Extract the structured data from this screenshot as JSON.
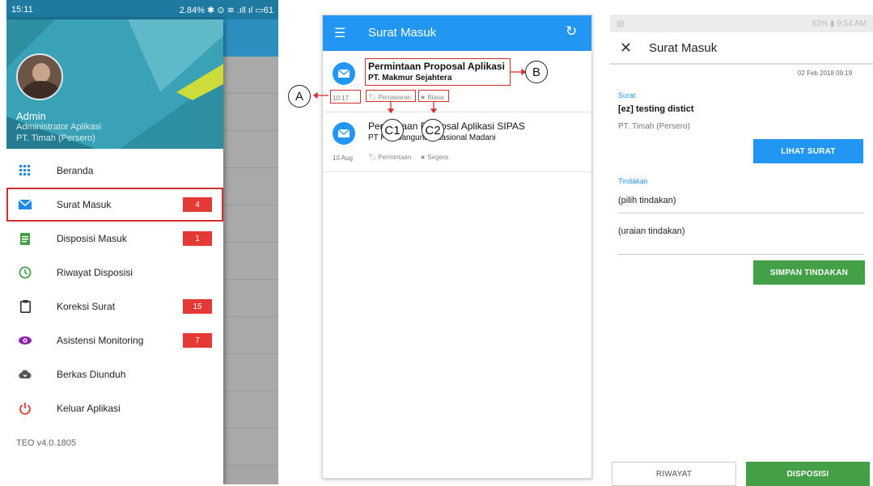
{
  "panel1": {
    "status": {
      "time": "15:11",
      "indicators": "2.84% ✱ ⊙ ≋ .ıll ıl ▭61"
    },
    "user": {
      "name": "Admin",
      "role": "Administrator Aplikasi",
      "org": "PT. Timah (Persero)"
    },
    "menu": [
      {
        "label": "Beranda",
        "icon": "grid-icon",
        "color": "#1e88e5"
      },
      {
        "label": "Surat Masuk",
        "icon": "envelope-icon",
        "color": "#1e88e5",
        "badge": "4"
      },
      {
        "label": "Disposisi Masuk",
        "icon": "document-icon",
        "color": "#43a047",
        "badge": "1"
      },
      {
        "label": "Riwayat Disposisi",
        "icon": "clock-icon",
        "color": "#43a047"
      },
      {
        "label": "Koreksi Surat",
        "icon": "clipboard-icon",
        "color": "#333333",
        "badge": "15"
      },
      {
        "label": "Asistensi Monitoring",
        "icon": "eye-icon",
        "color": "#8e24aa",
        "badge": "7"
      },
      {
        "label": "Berkas Diunduh",
        "icon": "cloud-download-icon",
        "color": "#555555"
      },
      {
        "label": "Keluar Aplikasi",
        "icon": "power-icon",
        "color": "#e53935"
      }
    ],
    "version": "TEO v4.0.1805"
  },
  "panel2": {
    "title": "Surat Masuk",
    "mails": [
      {
        "subject": "Permintaan Proposal Aplikasi",
        "sender": "PT. Makmur Sejahtera",
        "time": "10:17",
        "tags": [
          "Penawaran",
          "Biasa"
        ]
      },
      {
        "subject": "Permintaan Proposal Aplikasi SIPAS",
        "sender": "PT Pembangunan Nasional Madani",
        "time": "10 Aug",
        "tags": [
          "Permintaan",
          "Segera"
        ]
      }
    ],
    "annotations": {
      "a": "A",
      "b": "B",
      "c1": "C1",
      "c2": "C2"
    }
  },
  "panel3": {
    "status": {
      "battery": "63%",
      "time": "9:54 AM"
    },
    "title": "Surat Masuk",
    "date": "02 Feb 2018 09:19",
    "surat_label": "Surat",
    "surat_title": "[ez] testing distict",
    "surat_org": "PT. Timah (Persero)",
    "lihat_button": "LIHAT SURAT",
    "tindakan_label": "Tindakan",
    "pilih_placeholder": "(pilih tindakan)",
    "uraian_placeholder": "(uraian tindakan)",
    "simpan_button": "SIMPAN TINDAKAN",
    "riwayat_button": "RIWAYAT",
    "disposisi_button": "DISPOSISI",
    "accent_blue": "#2196f3",
    "accent_green": "#43a047"
  }
}
